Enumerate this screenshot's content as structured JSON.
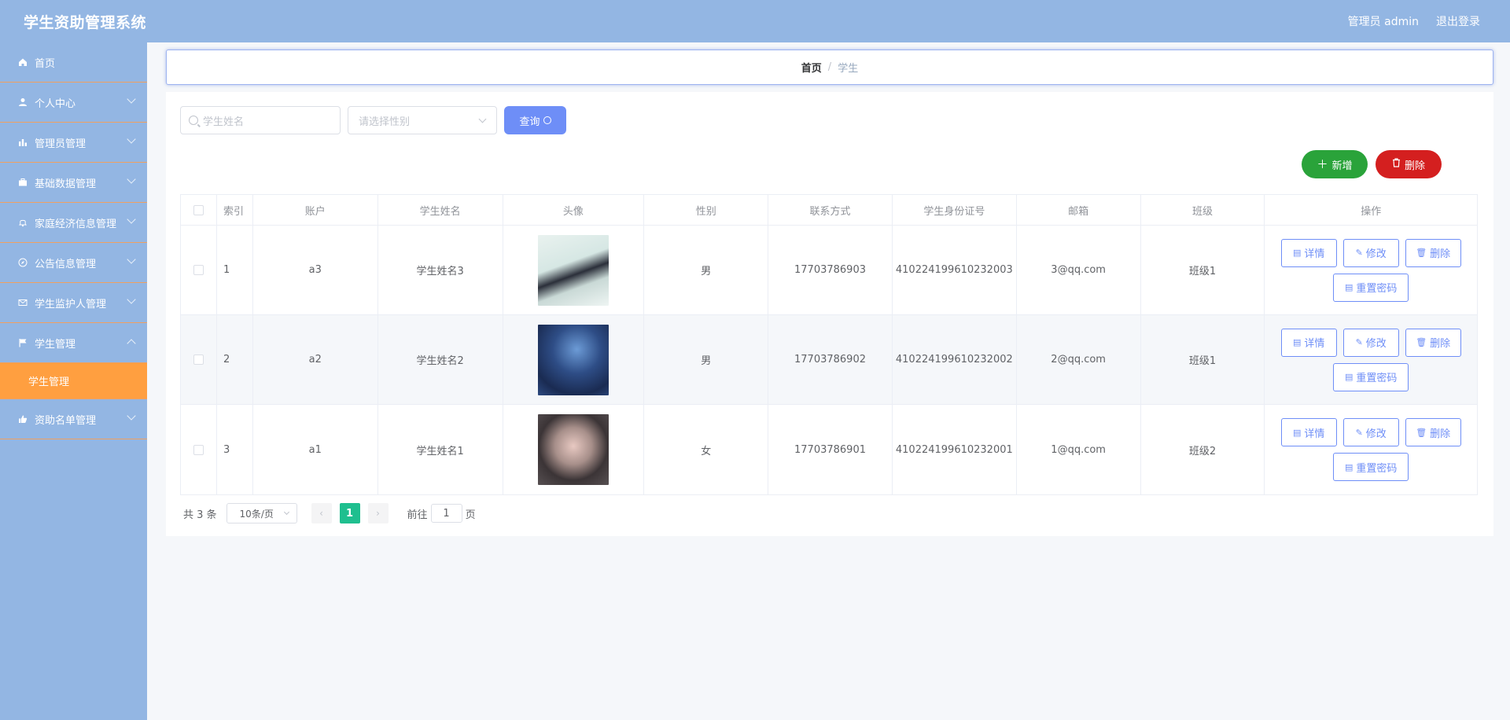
{
  "app": {
    "title": "学生资助管理系统"
  },
  "header": {
    "admin_label": "管理员 admin",
    "logout_label": "退出登录"
  },
  "sidebar": {
    "items": [
      {
        "label": "首页",
        "icon": "home-icon"
      },
      {
        "label": "个人中心",
        "icon": "user-icon"
      },
      {
        "label": "管理员管理",
        "icon": "bar-chart-icon"
      },
      {
        "label": "基础数据管理",
        "icon": "briefcase-icon"
      },
      {
        "label": "家庭经济信息管理",
        "icon": "bell-icon"
      },
      {
        "label": "公告信息管理",
        "icon": "compass-icon"
      },
      {
        "label": "学生监护人管理",
        "icon": "mail-icon"
      },
      {
        "label": "学生管理",
        "icon": "flag-icon"
      },
      {
        "label": "资助名单管理",
        "icon": "thumb-icon"
      }
    ],
    "active_submenu": "学生管理"
  },
  "breadcrumb": {
    "home": "首页",
    "separator": "/",
    "current": "学生"
  },
  "toolbar": {
    "search_placeholder": "学生姓名",
    "gender_placeholder": "请选择性别",
    "query_label": "查询",
    "add_label": "新增",
    "delete_label": "删除"
  },
  "table": {
    "columns": [
      "索引",
      "账户",
      "学生姓名",
      "头像",
      "性别",
      "联系方式",
      "学生身份证号",
      "邮箱",
      "班级",
      "操作"
    ],
    "rows": [
      {
        "index": "1",
        "account": "a3",
        "name": "学生姓名3",
        "gender": "男",
        "phone": "17703786903",
        "id_card": "410224199610232003",
        "email": "3@qq.com",
        "class": "班级1"
      },
      {
        "index": "2",
        "account": "a2",
        "name": "学生姓名2",
        "gender": "男",
        "phone": "17703786902",
        "id_card": "410224199610232002",
        "email": "2@qq.com",
        "class": "班级1"
      },
      {
        "index": "3",
        "account": "a1",
        "name": "学生姓名1",
        "gender": "女",
        "phone": "17703786901",
        "id_card": "410224199610232001",
        "email": "1@qq.com",
        "class": "班级2"
      }
    ],
    "actions": {
      "detail": "详情",
      "edit": "修改",
      "delete": "删除",
      "reset_password": "重置密码"
    }
  },
  "pagination": {
    "total": "共 3 条",
    "page_size": "10条/页",
    "current_page": "1",
    "goto_label": "前往",
    "goto_value": "1",
    "page_suffix": "页"
  },
  "colors": {
    "primary": "#6e8ef7",
    "sidebar": "#93b6e3",
    "active": "#ff9f40",
    "add": "#2aa33a",
    "danger": "#d41f1f",
    "page_active": "#1fbf8f"
  }
}
